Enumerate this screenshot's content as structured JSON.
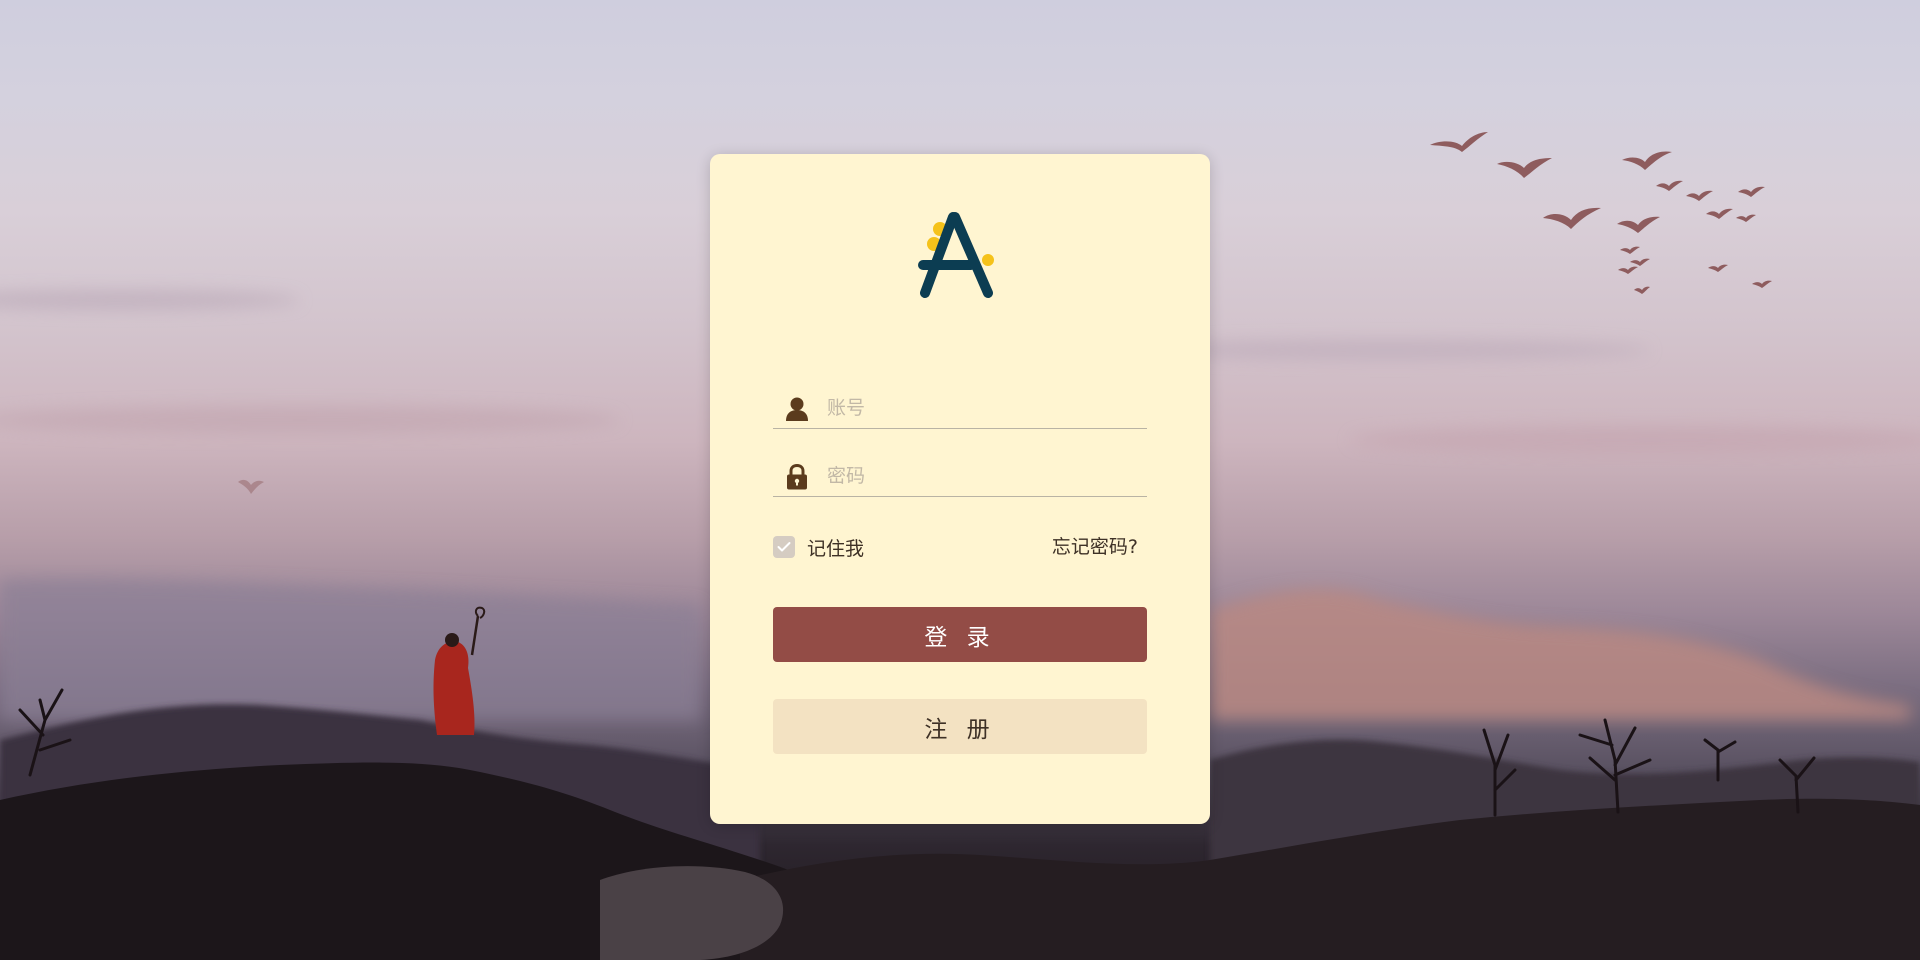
{
  "login_form": {
    "account_placeholder": "账号",
    "password_placeholder": "密码",
    "remember_label": "记住我",
    "remember_checked": true,
    "forgot_label": "忘记密码?",
    "login_button": "登 录",
    "register_button": "注 册"
  },
  "icons": {
    "logo": "letter-a-logo",
    "account": "user-icon",
    "password": "lock-icon",
    "remember": "check-icon"
  },
  "colors": {
    "card_background": "#fff5d1",
    "login_button": "#934c46",
    "register_button": "#f3e2c2",
    "logo_primary": "#0c3d52",
    "logo_accent": "#f5c21a"
  }
}
